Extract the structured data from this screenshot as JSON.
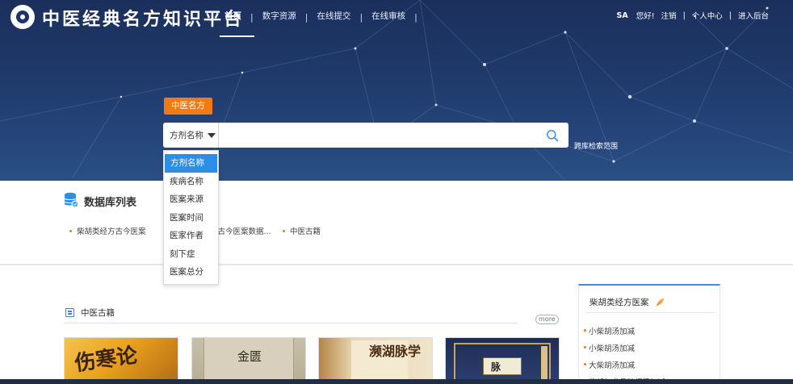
{
  "site": {
    "title": "中医经典名方知识平台"
  },
  "nav": {
    "items": [
      "首页",
      "数字资源",
      "在线提交",
      "在线审核"
    ],
    "separator": "|"
  },
  "user": {
    "name": "SA",
    "greeting": "您好!",
    "logout": "注销",
    "center": "个人中心",
    "admin": "进入后台",
    "separator": "|"
  },
  "search": {
    "tab_label": "中医名方",
    "select_value": "方剂名称",
    "input_value": "",
    "cross_search": "跨库检索范围",
    "options": [
      "方剂名称",
      "疾病名称",
      "医案来源",
      "医案时间",
      "医家作者",
      "刻下症",
      "医案总分"
    ]
  },
  "database": {
    "title": "数据库列表",
    "links": [
      "柴胡类经方古今医案",
      "方古今医案数据...",
      "中医古籍"
    ]
  },
  "classics": {
    "title": "中医古籍",
    "more": "more",
    "books": [
      {
        "cover_text": "伤寒论"
      },
      {
        "cover_text": "金匮"
      },
      {
        "cover_text": "濒湖脉学"
      },
      {
        "cover_text": "脉"
      }
    ]
  },
  "side_panel": {
    "title": "柴胡类经方医案",
    "items": [
      "小柴胡汤加减",
      "小柴胡汤加减",
      "大柴胡汤加减",
      "柴胡加龙骨牡蛎汤加减"
    ]
  },
  "colors": {
    "accent_orange": "#f07a13",
    "selected_blue": "#2d8ee6",
    "hero_navy": "#1b2f5c"
  }
}
